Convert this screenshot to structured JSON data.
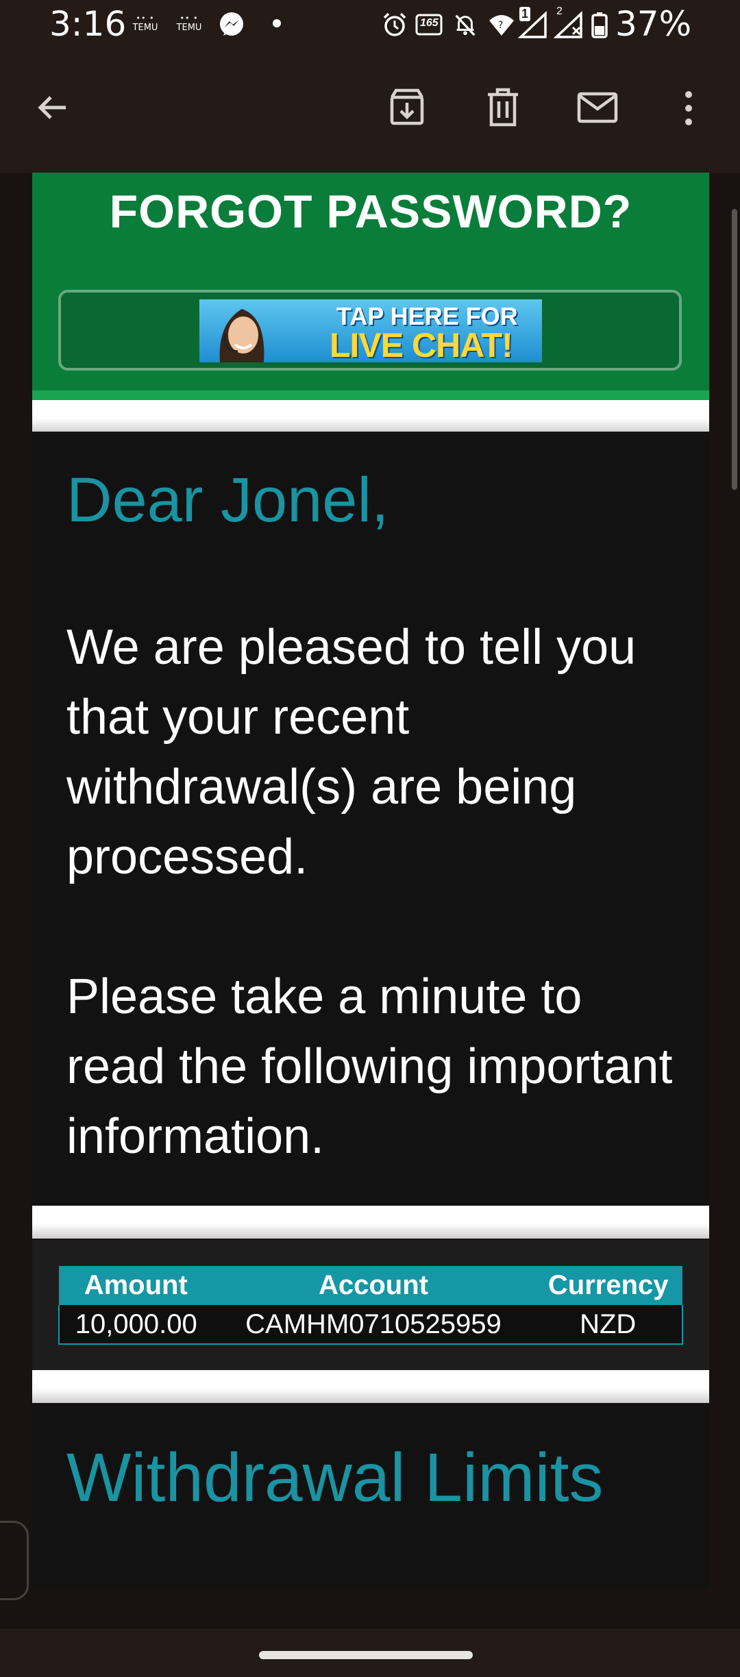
{
  "status_bar": {
    "time": "3:16",
    "temu_badge_1": "TEMU",
    "temu_badge_2": "TEMU",
    "refresh_rate": "165",
    "sim1": "1",
    "sim2": "2",
    "battery": "37%"
  },
  "toolbar": {
    "back": "arrow-left-icon",
    "archive": "archive-icon",
    "delete": "trash-icon",
    "mark_unread": "mail-icon",
    "more": "more-vert-icon"
  },
  "email": {
    "header_title": "FORGOT PASSWORD?",
    "chat_banner_line1": "TAP HERE FOR",
    "chat_banner_line2": "LIVE CHAT!",
    "greeting": "Dear Jonel,",
    "paragraph1": "We are pleased to tell you that your recent withdrawal(s) are being processed.",
    "paragraph2": "Please take a minute to read the following important information.",
    "table": {
      "headers": [
        "Amount",
        "Account",
        "Currency"
      ],
      "rows": [
        [
          "10,000.00",
          "CAMHM0710525959",
          "NZD"
        ]
      ]
    },
    "section_title": "Withdrawal Limits"
  },
  "colors": {
    "green": "#0b7d3b",
    "teal": "#1a93a2",
    "dark": "#121212",
    "chrome": "#241b16"
  }
}
